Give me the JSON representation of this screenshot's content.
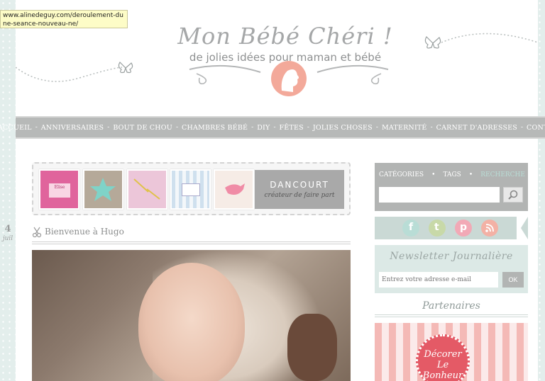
{
  "tooltip": {
    "url": "www.alinedeguy.com/deroulement-dune-seance-nouveau-ne/"
  },
  "header": {
    "title": "Mon Bébé Chéri !",
    "subtitle": "de jolies idées pour maman et bébé"
  },
  "nav": {
    "items": [
      "ACCUEIL",
      "ANNIVERSAIRES",
      "BOUT DE CHOU",
      "CHAMBRES BÉBÉ",
      "DIY",
      "FÊTES",
      "JOLIES CHOSES",
      "MATERNITÉ",
      "CARNET D'ADRESSES",
      "CONTACT"
    ],
    "separator": "-"
  },
  "banner": {
    "tile_label": "Elise",
    "brand": "DANCOURT",
    "tagline": "créateur de faire part"
  },
  "post": {
    "day": "4",
    "month": "juil",
    "title": "Bienvenue à Hugo"
  },
  "sidebar": {
    "tabs": [
      "CATÉGORIES",
      "TAGS",
      "RECHERCHE"
    ],
    "tab_separator": "•",
    "social_icons": [
      "facebook-icon",
      "twitter-icon",
      "pinterest-icon",
      "rss-icon"
    ],
    "newsletter_title": "Newsletter Journalière",
    "newsletter_placeholder": "Entrez votre adresse e-mail",
    "newsletter_button": "OK",
    "partners_title": "Partenaires",
    "partner_badge_line1": "Décorer",
    "partner_badge_line2": "Le Bonheur"
  },
  "colors": {
    "nav_bg": "#b7b9b8",
    "sidebar_box": "#b2b4b3",
    "accent_mint": "#b9ddd6",
    "accent_pink": "#f3a99a"
  }
}
